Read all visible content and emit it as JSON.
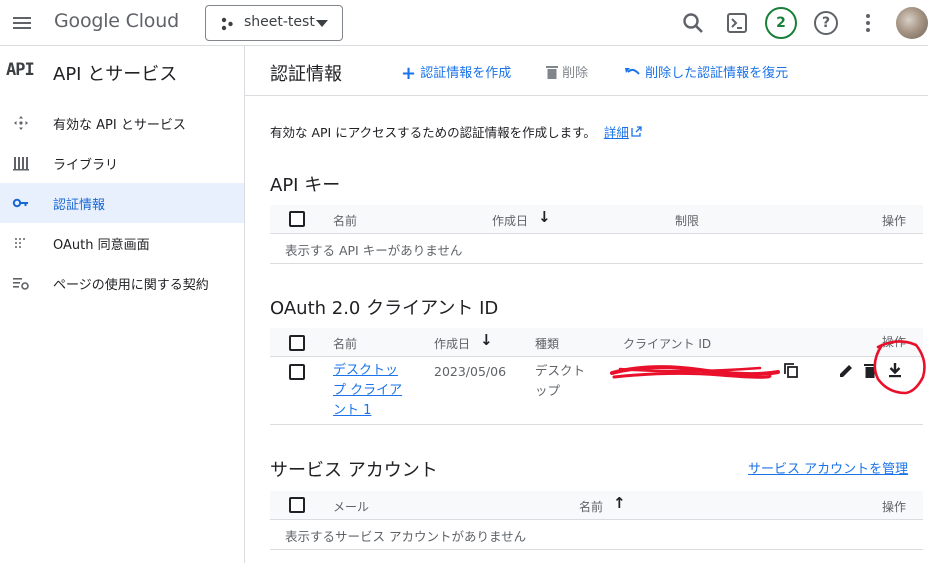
{
  "topbar": {
    "logo_google": "Google",
    "logo_cloud": "Cloud",
    "project_name": "sheet-test",
    "notification_count": "2",
    "icons": [
      "menu-icon",
      "search-icon",
      "terminal-icon",
      "help-icon",
      "more-vert-icon"
    ]
  },
  "sidebar": {
    "badge": "API",
    "title": "API とサービス",
    "items": [
      {
        "label": "有効な API とサービス",
        "icon": "services-icon",
        "active": false
      },
      {
        "label": "ライブラリ",
        "icon": "library-icon",
        "active": false
      },
      {
        "label": "認証情報",
        "icon": "key-icon",
        "active": true
      },
      {
        "label": "OAuth 同意画面",
        "icon": "consent-icon",
        "active": false
      },
      {
        "label": "ページの使用に関する契約",
        "icon": "settings-list-icon",
        "active": false
      }
    ]
  },
  "main": {
    "page_title": "認証情報",
    "actions": {
      "create": "認証情報を作成",
      "delete": "削除",
      "restore": "削除した認証情報を復元"
    },
    "intro_text": "有効な API にアクセスするための認証情報を作成します。",
    "intro_link": "詳細",
    "api_keys": {
      "title": "API キー",
      "columns": [
        "名前",
        "作成日",
        "制限",
        "操作"
      ],
      "empty_text": "表示する API キーがありません"
    },
    "oauth": {
      "title": "OAuth 2.0 クライアント ID",
      "columns": [
        "名前",
        "作成日",
        "種類",
        "クライアント ID",
        "操作"
      ],
      "rows": [
        {
          "name_lines": [
            "デスクトッ",
            "プ クライア",
            "ント 1"
          ],
          "created": "2023/05/06",
          "type_lines": [
            "デスクト",
            "ップ"
          ],
          "client_id": "(redacted)"
        }
      ]
    },
    "service_accounts": {
      "title": "サービス アカウント",
      "manage_link": "サービス アカウントを管理",
      "columns": [
        "メール",
        "名前",
        "操作"
      ],
      "empty_text": "表示するサービス アカウントがありません"
    },
    "annotation_color": "#e8102a",
    "accent_color": "#1a73e8"
  }
}
